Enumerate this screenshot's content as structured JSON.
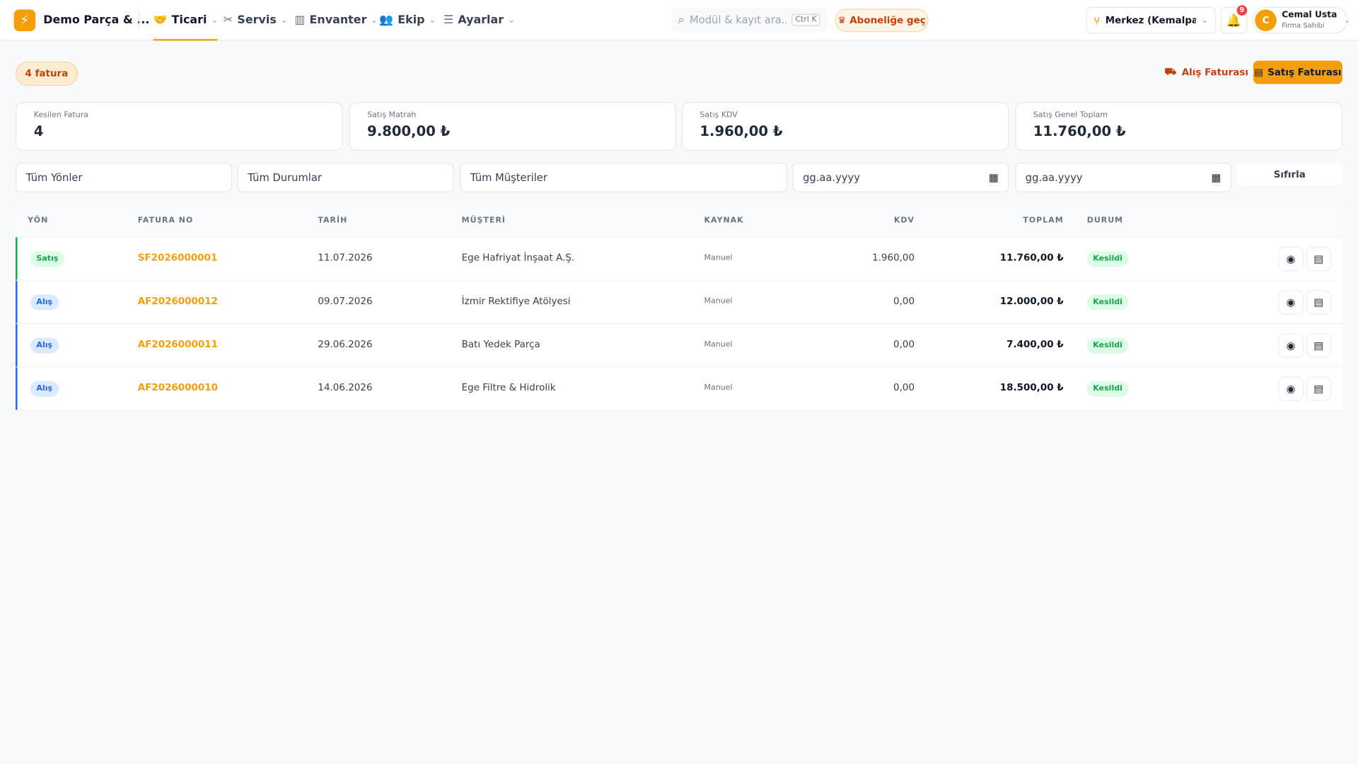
{
  "header": {
    "brand": "Demo Parça & ...",
    "nav": [
      {
        "label": "Ticari",
        "icon": "handshake-icon",
        "active": true
      },
      {
        "label": "Servis",
        "icon": "tools-icon"
      },
      {
        "label": "Envanter",
        "icon": "warehouse-icon"
      },
      {
        "label": "Ekip",
        "icon": "team-icon"
      },
      {
        "label": "Ayarlar",
        "icon": "sliders-icon"
      }
    ],
    "search_placeholder": "Modül & kayıt ara...",
    "search_shortcut": "Ctrl K",
    "subscribe_label": "Aboneliğe geç",
    "branch": "Merkez (Kemalpa...",
    "notification_count": "9",
    "user": {
      "initial": "C",
      "name": "Cemal Usta",
      "role": "Firma Sahibi"
    }
  },
  "toolbar": {
    "count_label": "4 fatura",
    "purchase_button": "Alış Faturası",
    "sale_button": "Satış Faturası"
  },
  "stats": [
    {
      "label": "Kesilen Fatura",
      "value": "4"
    },
    {
      "label": "Satış Matrah",
      "value": "9.800,00 ₺"
    },
    {
      "label": "Satış KDV",
      "value": "1.960,00 ₺"
    },
    {
      "label": "Satış Genel Toplam",
      "value": "11.760,00 ₺"
    }
  ],
  "filters": {
    "direction": "Tüm Yönler",
    "status": "Tüm Durumlar",
    "customer": "Tüm Müşteriler",
    "date_from": "gg.aa.yyyy",
    "date_to": "gg.aa.yyyy",
    "reset": "Sıfırla"
  },
  "table": {
    "columns": {
      "direction": "YÖN",
      "invoice_no": "FATURA NO",
      "date": "TARİH",
      "customer": "MÜŞTERİ",
      "source": "KAYNAK",
      "vat": "KDV",
      "total": "TOPLAM",
      "status": "DURUM"
    },
    "rows": [
      {
        "direction": "Satış",
        "invoice_no": "SF2026000001",
        "date": "11.07.2026",
        "customer": "Ege Hafriyat İnşaat A.Ş.",
        "source": "Manuel",
        "vat": "1.960,00",
        "total": "11.760,00 ₺",
        "status": "Kesildi"
      },
      {
        "direction": "Alış",
        "invoice_no": "AF2026000012",
        "date": "09.07.2026",
        "customer": "İzmir Rektifiye Atölyesi",
        "source": "Manuel",
        "vat": "0,00",
        "total": "12.000,00 ₺",
        "status": "Kesildi"
      },
      {
        "direction": "Alış",
        "invoice_no": "AF2026000011",
        "date": "29.06.2026",
        "customer": "Batı Yedek Parça",
        "source": "Manuel",
        "vat": "0,00",
        "total": "7.400,00 ₺",
        "status": "Kesildi"
      },
      {
        "direction": "Alış",
        "invoice_no": "AF2026000010",
        "date": "14.06.2026",
        "customer": "Ege Filtre & Hidrolik",
        "source": "Manuel",
        "vat": "0,00",
        "total": "18.500,00 ₺",
        "status": "Kesildi"
      }
    ]
  },
  "colors": {
    "accent": "#f59e0b",
    "sale": "#16a34a",
    "sale_bg": "#dcfce7",
    "purchase": "#2563eb",
    "purchase_bg": "#dbeafe",
    "status_ok": "#16a34a"
  }
}
